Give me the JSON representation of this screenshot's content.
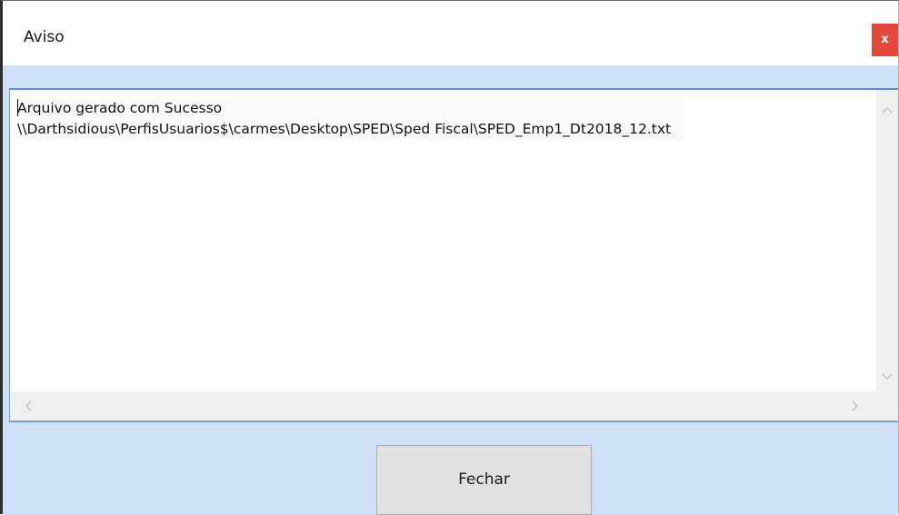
{
  "window": {
    "title": "Aviso",
    "close_label": "x"
  },
  "message": {
    "line1": "Arquivo gerado com Sucesso",
    "line2": "\\\\Darthsidious\\PerfisUsuarios$\\carmes\\Desktop\\SPED\\Sped Fiscal\\SPED_Emp1_Dt2018_12.txt"
  },
  "scrollbars": {
    "up_icon": "chevron-up-icon",
    "down_icon": "chevron-down-icon",
    "left_icon": "chevron-left-icon",
    "right_icon": "chevron-right-icon"
  },
  "footer": {
    "close_button_label": "Fechar"
  },
  "colors": {
    "dialog_background": "#cfe1f7",
    "close_button": "#e5483a",
    "accent_border": "#4f8ed8"
  }
}
